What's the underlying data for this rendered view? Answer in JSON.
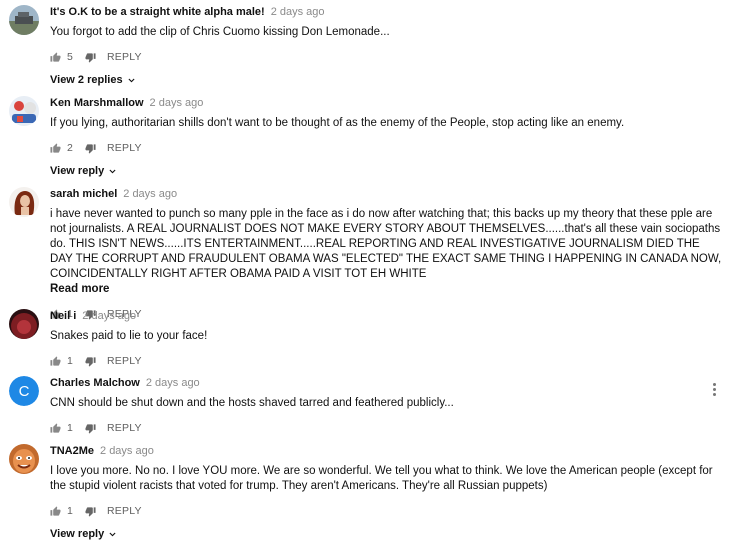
{
  "comments": [
    {
      "author": "It's O.K to be a straight white alpha male!",
      "time": "2 days ago",
      "text": "You forgot to add the clip of Chris Cuomo kissing Don Lemonade...",
      "likes": "5",
      "reply_label": "REPLY",
      "view_replies": "View 2 replies"
    },
    {
      "author": "Ken Marshmallow",
      "time": "2 days ago",
      "text": "If you lying, authoritarian shills don't want to be thought of as the enemy of the People, stop acting like an enemy.",
      "likes": "2",
      "reply_label": "REPLY",
      "view_replies": "View reply"
    },
    {
      "author": "sarah michel",
      "time": "2 days ago",
      "text": "i have never wanted to punch so many pple in the face as i do now after watching that; this backs up my theory that these pple are not journalists. A REAL JOURNALIST DOES NOT MAKE EVERY STORY ABOUT THEMSELVES......that's all these vain sociopaths do. THIS ISN'T NEWS......ITS ENTERTAINMENT.....REAL REPORTING AND REAL INVESTIGATIVE JOURNALISM DIED THE DAY THE CORRUPT AND FRAUDULENT OBAMA WAS \"ELECTED\"    THE EXACT SAME THING I HAPPENING IN CANADA NOW, COINCIDENTALLY RIGHT AFTER OBAMA PAID A VISIT TOT EH WHITE",
      "read_more": "Read more",
      "likes": "1",
      "reply_label": "REPLY"
    },
    {
      "author": "Neil i",
      "time": "2 days ago",
      "text": "Snakes paid to lie to your face!",
      "likes": "1",
      "reply_label": "REPLY"
    },
    {
      "author": "Charles Malchow",
      "time": "2 days ago",
      "avatar_letter": "C",
      "avatar_color": "#1e88e5",
      "text": "CNN should be shut down and the hosts shaved tarred and feathered publicly...",
      "likes": "1",
      "reply_label": "REPLY"
    },
    {
      "author": "TNA2Me",
      "time": "2 days ago",
      "text": "I love you more. No no. I love YOU more.  We are so wonderful.  We tell you what to think. We love the American people (except for the stupid violent racists that voted for trump. They aren't Americans. They're all Russian puppets)",
      "likes": "1",
      "reply_label": "REPLY",
      "view_replies": "View reply"
    }
  ]
}
